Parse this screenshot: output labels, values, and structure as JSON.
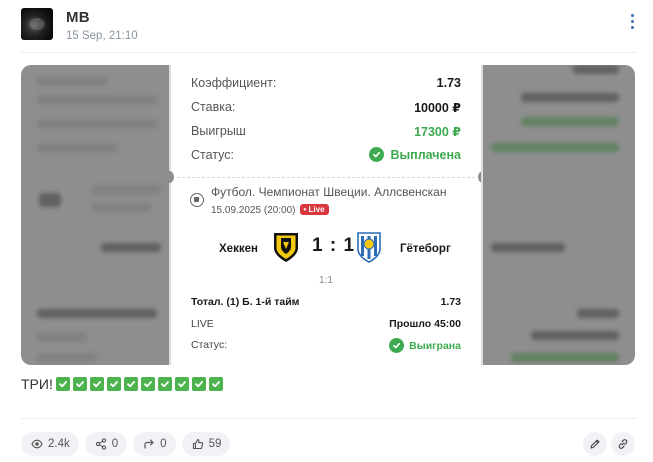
{
  "post": {
    "author": "MB",
    "timestamp": "15 Sep, 21:10",
    "text": "ТРИ!",
    "emoji_count_icon": "check-mark-button-emoji"
  },
  "bet_slip": {
    "coefficient_label": "Коэффициент:",
    "coefficient_value": "1.73",
    "stake_label": "Ставка:",
    "stake_value": "10000 ₽",
    "winnings_label": "Выигрыш",
    "winnings_value": "17300 ₽",
    "status_label": "Статус:",
    "status_value": "Выплачена",
    "event": {
      "league": "Футбол. Чемпионат Швеции. Аллсвенскан",
      "date": "15.09.2025 (20:00)",
      "live_badge": "• Live",
      "home_team": "Хеккен",
      "away_team": "Гётеборг",
      "score": "1 : 1",
      "half_time_score": "1:1",
      "market": "Тотал. (1) Б. 1-й тайм",
      "market_odds": "1.73",
      "period_label": "LIVE",
      "period_value": "Прошло 45:00",
      "event_status_label": "Статус:",
      "event_status_value": "Выиграна"
    }
  },
  "stats": {
    "views": "2.4k",
    "shares": "0",
    "reposts": "0",
    "likes": "59"
  },
  "colors": {
    "accent_green": "#3daa50",
    "live_red": "#d9363e",
    "link_blue": "#3a6fb0",
    "pill_bg": "#f0f2f5"
  }
}
